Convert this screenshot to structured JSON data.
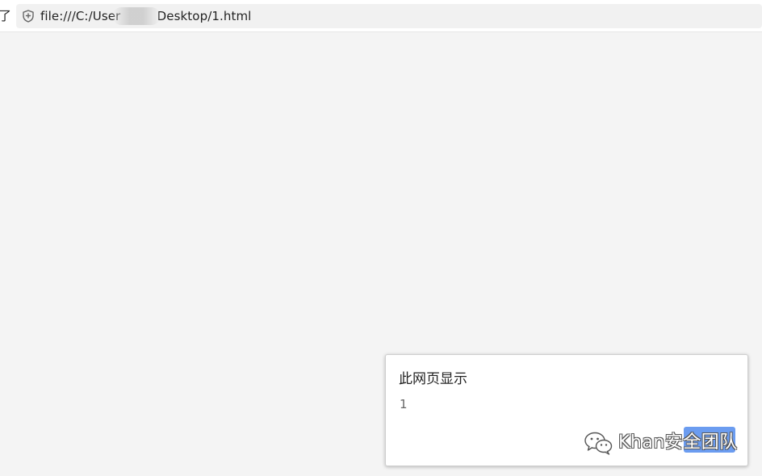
{
  "browser": {
    "left_glyph": "了",
    "url": "file:///C:/User   Desktop/1.html"
  },
  "dialog": {
    "title": "此网页显示",
    "message": "1",
    "ok_label": ""
  },
  "watermark": {
    "text": "Khan安全团队"
  },
  "colors": {
    "page_background": "#f4f4f4",
    "ok_button": "#6b9cf0"
  }
}
